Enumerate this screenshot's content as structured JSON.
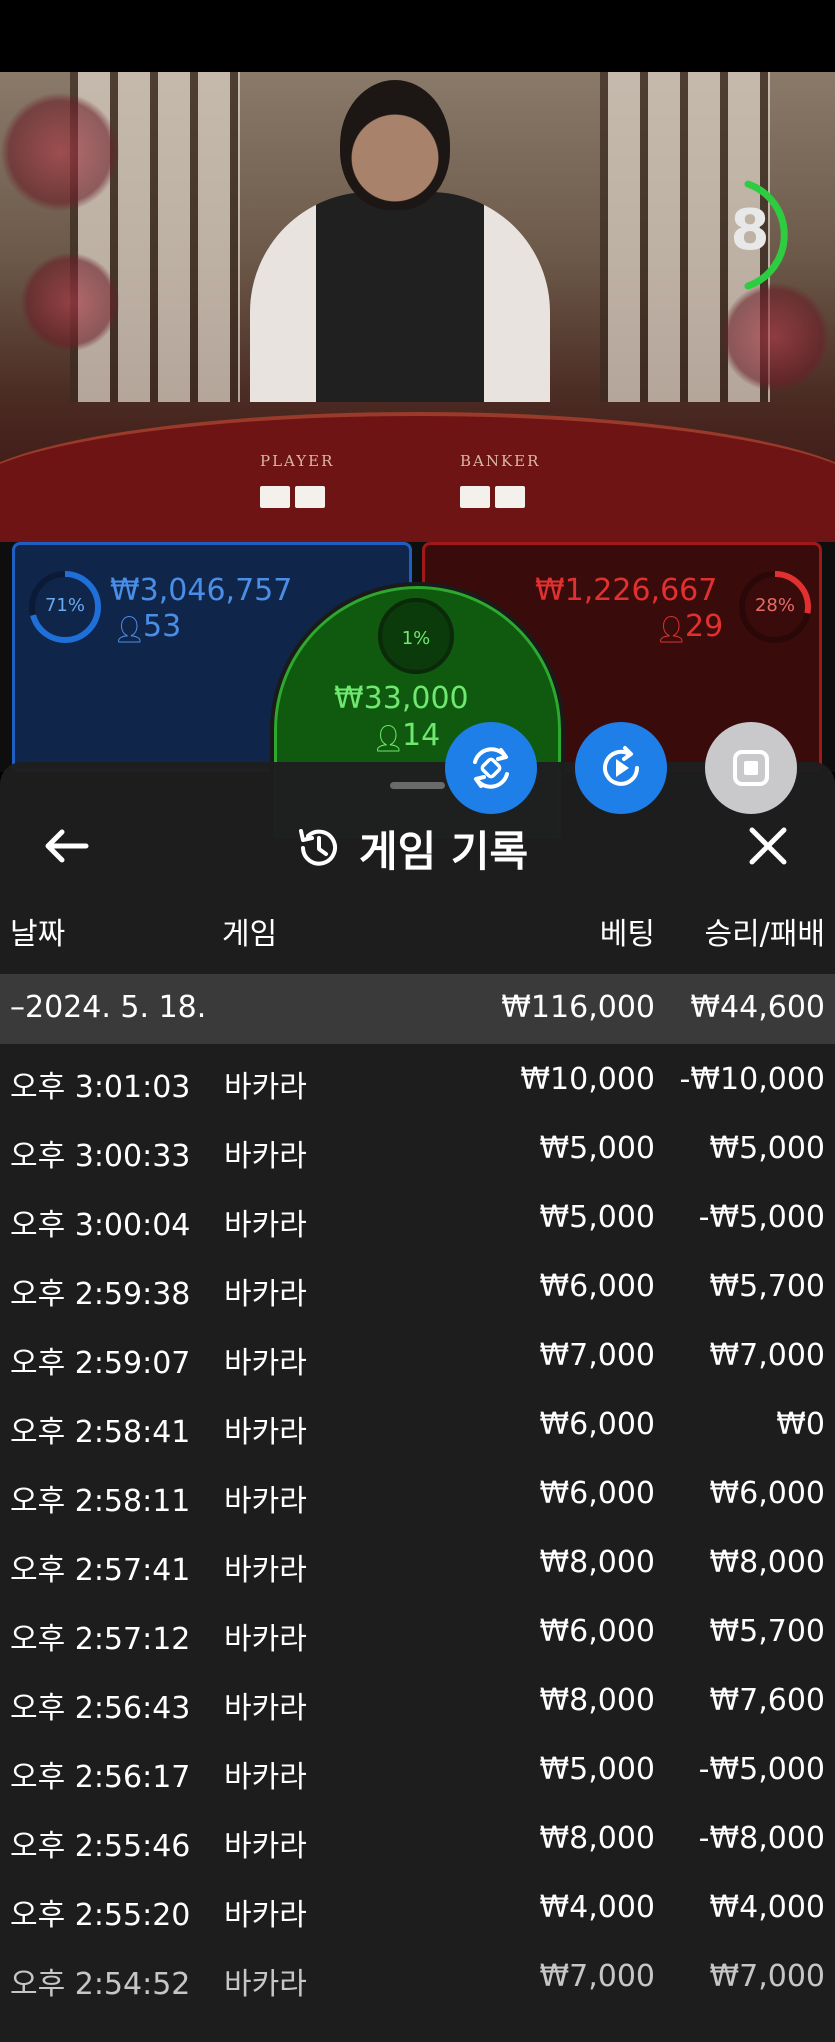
{
  "video": {
    "timer": "8",
    "timer_color": "#2ecc40",
    "table_labels": [
      "PLAYER",
      "BANKER"
    ]
  },
  "bets": {
    "player": {
      "percent": "71%",
      "amount": "₩3,046,757",
      "count": "53",
      "color": "#1f6fd8"
    },
    "tie": {
      "percent": "1%",
      "amount": "₩33,000",
      "count": "14",
      "color": "#2ecc40"
    },
    "banker": {
      "percent": "28%",
      "amount": "₩1,226,667",
      "count": "29",
      "color": "#e03030"
    }
  },
  "fab": {
    "rotate_icon": "rotate-icon",
    "replay_icon": "replay-icon",
    "stop_icon": "stop-icon"
  },
  "sheet": {
    "title": "게임 기록",
    "back_icon": "arrow-left-icon",
    "history_icon": "history-icon",
    "close_icon": "close-icon",
    "columns": {
      "date": "날짜",
      "game": "게임",
      "bet": "베팅",
      "result": "승리/패배"
    },
    "group": {
      "date": "–2024. 5. 18.",
      "bet": "₩116,000",
      "result": "₩44,600"
    },
    "rows": [
      {
        "time": "오후 3:01:03",
        "game": "바카라",
        "bet": "₩10,000",
        "result": "-₩10,000"
      },
      {
        "time": "오후 3:00:33",
        "game": "바카라",
        "bet": "₩5,000",
        "result": "₩5,000"
      },
      {
        "time": "오후 3:00:04",
        "game": "바카라",
        "bet": "₩5,000",
        "result": "-₩5,000"
      },
      {
        "time": "오후 2:59:38",
        "game": "바카라",
        "bet": "₩6,000",
        "result": "₩5,700"
      },
      {
        "time": "오후 2:59:07",
        "game": "바카라",
        "bet": "₩7,000",
        "result": "₩7,000"
      },
      {
        "time": "오후 2:58:41",
        "game": "바카라",
        "bet": "₩6,000",
        "result": "₩0"
      },
      {
        "time": "오후 2:58:11",
        "game": "바카라",
        "bet": "₩6,000",
        "result": "₩6,000"
      },
      {
        "time": "오후 2:57:41",
        "game": "바카라",
        "bet": "₩8,000",
        "result": "₩8,000"
      },
      {
        "time": "오후 2:57:12",
        "game": "바카라",
        "bet": "₩6,000",
        "result": "₩5,700"
      },
      {
        "time": "오후 2:56:43",
        "game": "바카라",
        "bet": "₩8,000",
        "result": "₩7,600"
      },
      {
        "time": "오후 2:56:17",
        "game": "바카라",
        "bet": "₩5,000",
        "result": "-₩5,000"
      },
      {
        "time": "오후 2:55:46",
        "game": "바카라",
        "bet": "₩8,000",
        "result": "-₩8,000"
      },
      {
        "time": "오후 2:55:20",
        "game": "바카라",
        "bet": "₩4,000",
        "result": "₩4,000"
      },
      {
        "time": "오후 2:54:52",
        "game": "바카라",
        "bet": "₩7,000",
        "result": "₩7,000"
      }
    ]
  }
}
